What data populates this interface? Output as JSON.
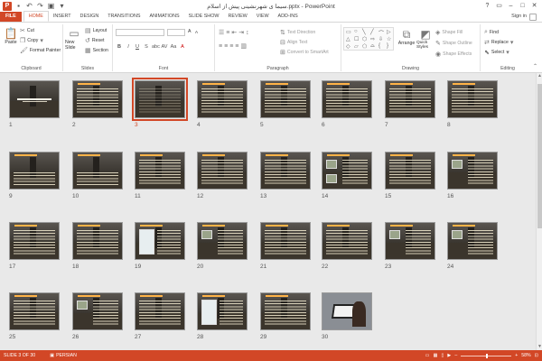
{
  "app": {
    "title": "سیما ی شهرنشینی پیش از اسلام.pptx - PowerPoint",
    "logo_letter": "P",
    "window_controls": [
      "?",
      "▭",
      "–",
      "□",
      "✕"
    ]
  },
  "tabs": [
    {
      "label": "FILE",
      "kind": "file"
    },
    {
      "label": "HOME",
      "kind": "active"
    },
    {
      "label": "INSERT",
      "kind": ""
    },
    {
      "label": "DESIGN",
      "kind": ""
    },
    {
      "label": "TRANSITIONS",
      "kind": ""
    },
    {
      "label": "ANIMATIONS",
      "kind": ""
    },
    {
      "label": "SLIDE SHOW",
      "kind": ""
    },
    {
      "label": "REVIEW",
      "kind": ""
    },
    {
      "label": "VIEW",
      "kind": ""
    },
    {
      "label": "ADD-INS",
      "kind": ""
    }
  ],
  "signin": "Sign in",
  "ribbon": {
    "clipboard": {
      "label": "Clipboard",
      "paste": "Paste",
      "cut": "Cut",
      "copy": "Copy",
      "format_painter": "Format Painter"
    },
    "slides": {
      "label": "Slides",
      "new_slide": "New Slide",
      "layout": "Layout",
      "reset": "Reset",
      "section": "Section"
    },
    "font": {
      "label": "Font",
      "buttons": [
        "B",
        "I",
        "U",
        "S",
        "abc",
        "AV",
        "Aa",
        "A"
      ],
      "grow": "A",
      "shrink": "A"
    },
    "paragraph": {
      "label": "Paragraph",
      "text_direction": "Text Direction",
      "align_text": "Align Text",
      "convert": "Convert to SmartArt"
    },
    "drawing": {
      "label": "Drawing",
      "arrange": "Arrange",
      "quick_styles": "Quick Styles",
      "shape_fill": "Shape Fill",
      "shape_outline": "Shape Outline",
      "shape_effects": "Shape Effects"
    },
    "editing": {
      "label": "Editing",
      "find": "Find",
      "replace": "Replace",
      "select": "Select"
    }
  },
  "slides": [
    {
      "n": "1",
      "kind": "title"
    },
    {
      "n": "2",
      "kind": "list"
    },
    {
      "n": "3",
      "kind": "dark",
      "selected": true
    },
    {
      "n": "4",
      "kind": "text"
    },
    {
      "n": "5",
      "kind": "text"
    },
    {
      "n": "6",
      "kind": "text"
    },
    {
      "n": "7",
      "kind": "text"
    },
    {
      "n": "8",
      "kind": "text"
    },
    {
      "n": "9",
      "kind": "sparse"
    },
    {
      "n": "10",
      "kind": "sparse"
    },
    {
      "n": "11",
      "kind": "text"
    },
    {
      "n": "12",
      "kind": "text"
    },
    {
      "n": "13",
      "kind": "text"
    },
    {
      "n": "14",
      "kind": "pictures"
    },
    {
      "n": "15",
      "kind": "text"
    },
    {
      "n": "16",
      "kind": "picture"
    },
    {
      "n": "17",
      "kind": "text"
    },
    {
      "n": "18",
      "kind": "text"
    },
    {
      "n": "19",
      "kind": "tallpic"
    },
    {
      "n": "20",
      "kind": "picture"
    },
    {
      "n": "21",
      "kind": "text"
    },
    {
      "n": "22",
      "kind": "text"
    },
    {
      "n": "23",
      "kind": "picture"
    },
    {
      "n": "24",
      "kind": "picture"
    },
    {
      "n": "25",
      "kind": "text"
    },
    {
      "n": "26",
      "kind": "picture"
    },
    {
      "n": "27",
      "kind": "text"
    },
    {
      "n": "28",
      "kind": "tallpic"
    },
    {
      "n": "29",
      "kind": "text"
    },
    {
      "n": "30",
      "kind": "photo"
    }
  ],
  "status": {
    "slide_info": "SLIDE 3 OF 30",
    "language": "PERSIAN",
    "zoom": "58%",
    "zoom_minus": "–",
    "zoom_plus": "+"
  },
  "colors": {
    "accent": "#d24726"
  }
}
